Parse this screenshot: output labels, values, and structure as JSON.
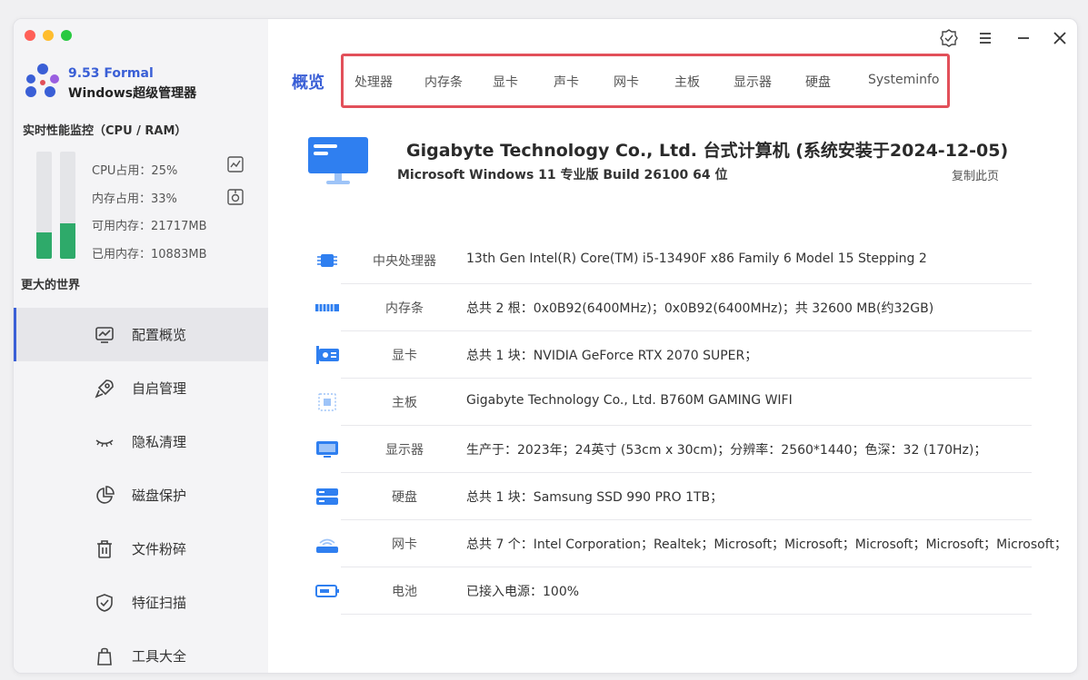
{
  "sidebar": {
    "version": "9.53 Formal",
    "app_name": "Windows超级管理器",
    "perf_title": "实时性能监控（CPU / RAM）",
    "cpu_usage_label": "CPU占用：25%",
    "mem_usage_label": "内存占用：33%",
    "available_mem_label": "可用内存：21717MB",
    "used_mem_label": "已用内存：10883MB",
    "cpu_fraction": 0.25,
    "ram_fraction": 0.33,
    "world_text": "更大的世界",
    "nav": [
      {
        "label": "配置概览",
        "icon": "chart-icon",
        "active": true
      },
      {
        "label": "自启管理",
        "icon": "rocket-icon",
        "active": false
      },
      {
        "label": "隐私清理",
        "icon": "eye-closed-icon",
        "active": false
      },
      {
        "label": "磁盘保护",
        "icon": "pie-chart-icon",
        "active": false
      },
      {
        "label": "文件粉碎",
        "icon": "trash-icon",
        "active": false
      },
      {
        "label": "特征扫描",
        "icon": "shield-check-icon",
        "active": false
      },
      {
        "label": "工具大全",
        "icon": "bag-icon",
        "active": false
      }
    ]
  },
  "tabs": {
    "active": "概览",
    "items": [
      "处理器",
      "内存条",
      "显卡",
      "声卡",
      "网卡",
      "主板",
      "显示器",
      "硬盘",
      "Systeminfo"
    ]
  },
  "header": {
    "title": "Gigabyte Technology Co., Ltd.  台式计算机 (系统安装于2024-12-05)",
    "subtitle": "Microsoft Windows 11 专业版 Build 26100 64 位",
    "copy_label": "复制此页"
  },
  "specs": [
    {
      "label": "中央处理器",
      "value": "13th Gen Intel(R) Core(TM) i5-13490F x86 Family 6 Model 15 Stepping 2",
      "icon": "cpu-icon"
    },
    {
      "label": "内存条",
      "value": "总共 2 根：0x0B92(6400MHz)；0x0B92(6400MHz)；共 32600 MB(约32GB)",
      "icon": "ram-icon"
    },
    {
      "label": "显卡",
      "value": "总共 1 块：NVIDIA GeForce RTX 2070 SUPER；",
      "icon": "gpu-icon"
    },
    {
      "label": "主板",
      "value": "Gigabyte Technology Co., Ltd.  B760M GAMING WIFI",
      "icon": "motherboard-icon"
    },
    {
      "label": "显示器",
      "value": "生产于：2023年；24英寸 (53cm x 30cm)；分辨率：2560*1440；色深：32  (170Hz)；",
      "icon": "display-icon"
    },
    {
      "label": "硬盘",
      "value": "总共 1 块：Samsung SSD 990 PRO 1TB；",
      "icon": "disk-icon"
    },
    {
      "label": "网卡",
      "value": "总共 7 个：Intel Corporation；Realtek；Microsoft；Microsoft；Microsoft；Microsoft；Microsoft；",
      "icon": "network-icon"
    },
    {
      "label": "电池",
      "value": "已接入电源：100%",
      "icon": "battery-icon"
    }
  ],
  "colors": {
    "accent": "#3a5fd6",
    "bar_fill": "#2eaa6a",
    "tab_box_border": "#e2505a",
    "icon_blue": "#2f7ff0"
  }
}
